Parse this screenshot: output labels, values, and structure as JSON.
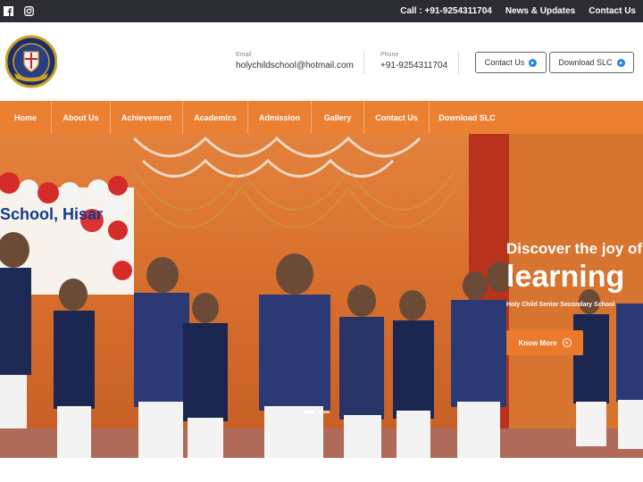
{
  "topbar": {
    "call": "Call : +91-9254311704",
    "news": "News & Updates",
    "contact": "Contact Us"
  },
  "header": {
    "email_label": "Email",
    "email_value": "holychildschool@hotmail.com",
    "phone_label": "Phone",
    "phone_value": "+91-9254311704",
    "contact_btn": "Contact Us",
    "download_btn": "Download SLC"
  },
  "nav": {
    "items": [
      "Home",
      "About Us",
      "Achievement",
      "Academics",
      "Admission",
      "Gallery",
      "Contact Us",
      "Download SLC"
    ]
  },
  "hero": {
    "line1": "Discover the joy of",
    "line2": "learning",
    "line3": "Holy Child Senior Secondary School",
    "button": "Know More",
    "banner": "School, Hisar"
  },
  "colors": {
    "accent": "#ec8032",
    "topbar": "#2c2c34",
    "button_icon": "#1e88e5"
  }
}
